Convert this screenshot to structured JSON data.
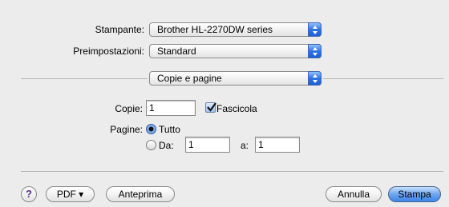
{
  "printer": {
    "label": "Stampante:",
    "value": "Brother HL-2270DW series"
  },
  "presets": {
    "label": "Preimpostazioni:",
    "value": "Standard"
  },
  "pane": {
    "value": "Copie e pagine"
  },
  "copies": {
    "label": "Copie:",
    "value": "1",
    "collate_label": "Fascicola",
    "collate_checked": true
  },
  "pages": {
    "label": "Pagine:",
    "all_label": "Tutto",
    "all_selected": true,
    "from_label": "Da:",
    "from_value": "1",
    "to_label": "a:",
    "to_value": "1"
  },
  "footer": {
    "help": "?",
    "pdf": "PDF ▾",
    "preview": "Anteprima",
    "cancel": "Annulla",
    "print": "Stampa"
  },
  "colors": {
    "accent": "#3c86e8",
    "background": "#ececec"
  }
}
